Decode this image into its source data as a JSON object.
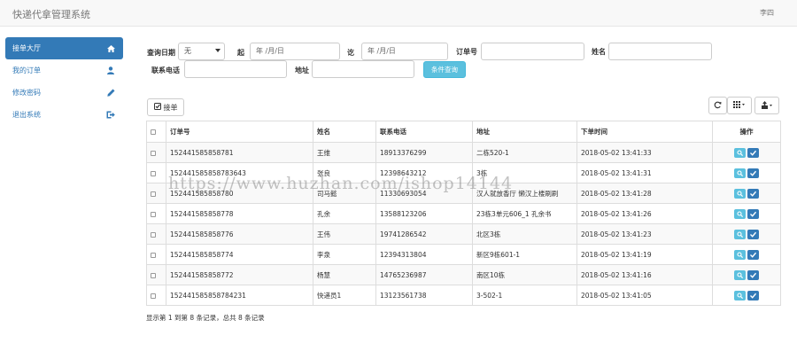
{
  "header": {
    "title": "快递代拿管理系统",
    "user": "李四"
  },
  "sidebar": {
    "items": [
      {
        "label": "接单大厅",
        "icon": "home-icon",
        "active": true
      },
      {
        "label": "我的订单",
        "icon": "user-icon",
        "active": false
      },
      {
        "label": "修改密码",
        "icon": "pencil-icon",
        "active": false
      },
      {
        "label": "退出系统",
        "icon": "logout-icon",
        "active": false
      }
    ]
  },
  "filters": {
    "date_label": "查询日期",
    "date_select": "无",
    "from_label": "起",
    "date_from_placeholder": "年 /月/日",
    "to_label": "讫",
    "date_to_placeholder": "年 /月/日",
    "order_no_label": "订单号",
    "name_label": "姓名",
    "phone_label": "联系电话",
    "address_label": "地址",
    "search_button": "条件查询"
  },
  "toolbar": {
    "receive_button": "接单",
    "refresh_icon": "refresh-icon",
    "columns_icon": "columns-icon",
    "export_icon": "export-icon"
  },
  "table": {
    "headers": [
      "订单号",
      "姓名",
      "联系电话",
      "地址",
      "下单时间",
      "操作"
    ],
    "rows": [
      {
        "order": "152441585858781",
        "name": "王维",
        "phone": "18913376299",
        "address": "二栋520-1",
        "time": "2018-05-02 13:41:33"
      },
      {
        "order": "152441585858783643",
        "name": "张良",
        "phone": "12398643212",
        "address": "3栋",
        "time": "2018-05-02 13:41:31"
      },
      {
        "order": "152441585858780",
        "name": "司马懿",
        "phone": "11330693054",
        "address": "汉人就放香厅 懒汉上楼刷刷",
        "time": "2018-05-02 13:41:28"
      },
      {
        "order": "152441585858778",
        "name": "孔余",
        "phone": "13588123206",
        "address": "23栋3单元606_1 孔余书",
        "time": "2018-05-02 13:41:26"
      },
      {
        "order": "152441585858776",
        "name": "王伟",
        "phone": "19741286542",
        "address": "北区3栋",
        "time": "2018-05-02 13:41:23"
      },
      {
        "order": "152441585858774",
        "name": "李泉",
        "phone": "12394313804",
        "address": "新区9栋601-1",
        "time": "2018-05-02 13:41:19"
      },
      {
        "order": "152441585858772",
        "name": "杨慧",
        "phone": "14765236987",
        "address": "南区10栋",
        "time": "2018-05-02 13:41:16"
      },
      {
        "order": "152441585858784231",
        "name": "快递员1",
        "phone": "13123561738",
        "address": "3-502-1",
        "time": "2018-05-02 13:41:05"
      }
    ]
  },
  "pagination": {
    "info": "显示第 1 到第 8 条记录，总共 8 条记录"
  },
  "watermark": "https://www.huzhan.com/ishop14144",
  "colors": {
    "primary": "#337ab7",
    "info": "#5bc0de"
  }
}
